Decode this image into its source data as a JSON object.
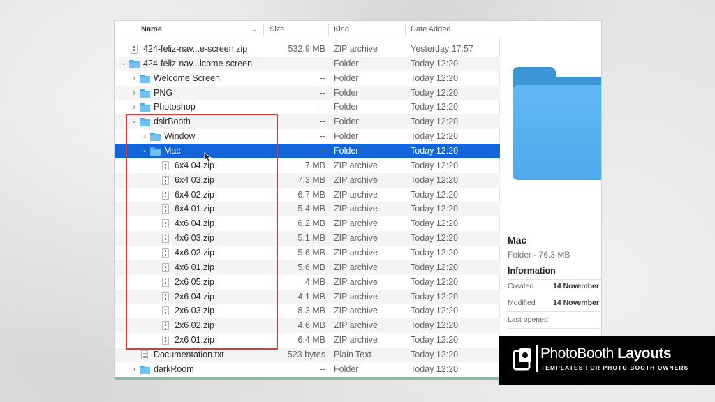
{
  "columns": {
    "name": "Name",
    "size": "Size",
    "kind": "Kind",
    "date_added": "Date Added"
  },
  "rows": [
    {
      "name": "424-feliz-nav...e-screen.zip",
      "size": "532.9 MB",
      "kind": "ZIP archive",
      "date": "Yesterday 17:57",
      "type": "zip",
      "level": 0,
      "disclosure": ""
    },
    {
      "name": "424-feliz-nav...lcome-screen",
      "size": "--",
      "kind": "Folder",
      "date": "Today 12:20",
      "type": "folder",
      "level": 0,
      "disclosure": "open"
    },
    {
      "name": "Welcome Screen",
      "size": "--",
      "kind": "Folder",
      "date": "Today 12:20",
      "type": "folder",
      "level": 1,
      "disclosure": "closed"
    },
    {
      "name": "PNG",
      "size": "--",
      "kind": "Folder",
      "date": "Today 12:20",
      "type": "folder",
      "level": 1,
      "disclosure": "closed"
    },
    {
      "name": "Photoshop",
      "size": "--",
      "kind": "Folder",
      "date": "Today 12:20",
      "type": "folder",
      "level": 1,
      "disclosure": "closed"
    },
    {
      "name": "dslrBooth",
      "size": "--",
      "kind": "Folder",
      "date": "Today 12:20",
      "type": "folder",
      "level": 1,
      "disclosure": "open"
    },
    {
      "name": "Window",
      "size": "--",
      "kind": "Folder",
      "date": "Today 12:20",
      "type": "folder",
      "level": 2,
      "disclosure": "closed"
    },
    {
      "name": "Mac",
      "size": "--",
      "kind": "Folder",
      "date": "Today 12:20",
      "type": "folder",
      "level": 2,
      "disclosure": "open",
      "selected": true
    },
    {
      "name": "6x4 04.zip",
      "size": "7 MB",
      "kind": "ZIP archive",
      "date": "Today 12:20",
      "type": "zip",
      "level": 3,
      "disclosure": ""
    },
    {
      "name": "6x4 03.zip",
      "size": "7.3 MB",
      "kind": "ZIP archive",
      "date": "Today 12:20",
      "type": "zip",
      "level": 3,
      "disclosure": ""
    },
    {
      "name": "6x4 02.zip",
      "size": "6.7 MB",
      "kind": "ZIP archive",
      "date": "Today 12:20",
      "type": "zip",
      "level": 3,
      "disclosure": ""
    },
    {
      "name": "6x4 01.zip",
      "size": "5.4 MB",
      "kind": "ZIP archive",
      "date": "Today 12:20",
      "type": "zip",
      "level": 3,
      "disclosure": ""
    },
    {
      "name": "4x6 04.zip",
      "size": "6.2 MB",
      "kind": "ZIP archive",
      "date": "Today 12:20",
      "type": "zip",
      "level": 3,
      "disclosure": ""
    },
    {
      "name": "4x6 03.zip",
      "size": "5.1 MB",
      "kind": "ZIP archive",
      "date": "Today 12:20",
      "type": "zip",
      "level": 3,
      "disclosure": ""
    },
    {
      "name": "4x6 02.zip",
      "size": "5.6 MB",
      "kind": "ZIP archive",
      "date": "Today 12:20",
      "type": "zip",
      "level": 3,
      "disclosure": ""
    },
    {
      "name": "4x6 01.zip",
      "size": "5.6 MB",
      "kind": "ZIP archive",
      "date": "Today 12:20",
      "type": "zip",
      "level": 3,
      "disclosure": ""
    },
    {
      "name": "2x6 05.zip",
      "size": "4 MB",
      "kind": "ZIP archive",
      "date": "Today 12:20",
      "type": "zip",
      "level": 3,
      "disclosure": ""
    },
    {
      "name": "2x6 04.zip",
      "size": "4.1 MB",
      "kind": "ZIP archive",
      "date": "Today 12:20",
      "type": "zip",
      "level": 3,
      "disclosure": ""
    },
    {
      "name": "2x6 03.zip",
      "size": "8.3 MB",
      "kind": "ZIP archive",
      "date": "Today 12:20",
      "type": "zip",
      "level": 3,
      "disclosure": ""
    },
    {
      "name": "2x6 02.zip",
      "size": "4.6 MB",
      "kind": "ZIP archive",
      "date": "Today 12:20",
      "type": "zip",
      "level": 3,
      "disclosure": ""
    },
    {
      "name": "2x6 01.zip",
      "size": "6.4 MB",
      "kind": "ZIP archive",
      "date": "Today 12:20",
      "type": "zip",
      "level": 3,
      "disclosure": ""
    },
    {
      "name": "Documentation.txt",
      "size": "523 bytes",
      "kind": "Plain Text",
      "date": "Today 12:20",
      "type": "txt",
      "level": 1,
      "disclosure": ""
    },
    {
      "name": "darkRoom",
      "size": "--",
      "kind": "Folder",
      "date": "Today 12:20",
      "type": "folder",
      "level": 1,
      "disclosure": "closed"
    }
  ],
  "preview": {
    "name": "Mac",
    "subtitle": "Folder - 76.3 MB",
    "info_heading": "Information",
    "created_label": "Created",
    "created_value": "14 November",
    "modified_label": "Modified",
    "modified_value": "14 November",
    "last_opened_label": "Last opened"
  },
  "brand": {
    "name_light": "PhotoBooth ",
    "name_bold": "Layouts",
    "tagline": "TEMPLATES FOR PHOTO BOOTH OWNERS"
  },
  "colors": {
    "selection": "#1264d8",
    "highlight_box": "#d9393a",
    "folder": "#5bb6ee"
  },
  "icons": {
    "folder": "folder-icon",
    "zip": "zip-file-icon",
    "txt": "text-file-icon",
    "sort": "chevron-down-icon"
  }
}
